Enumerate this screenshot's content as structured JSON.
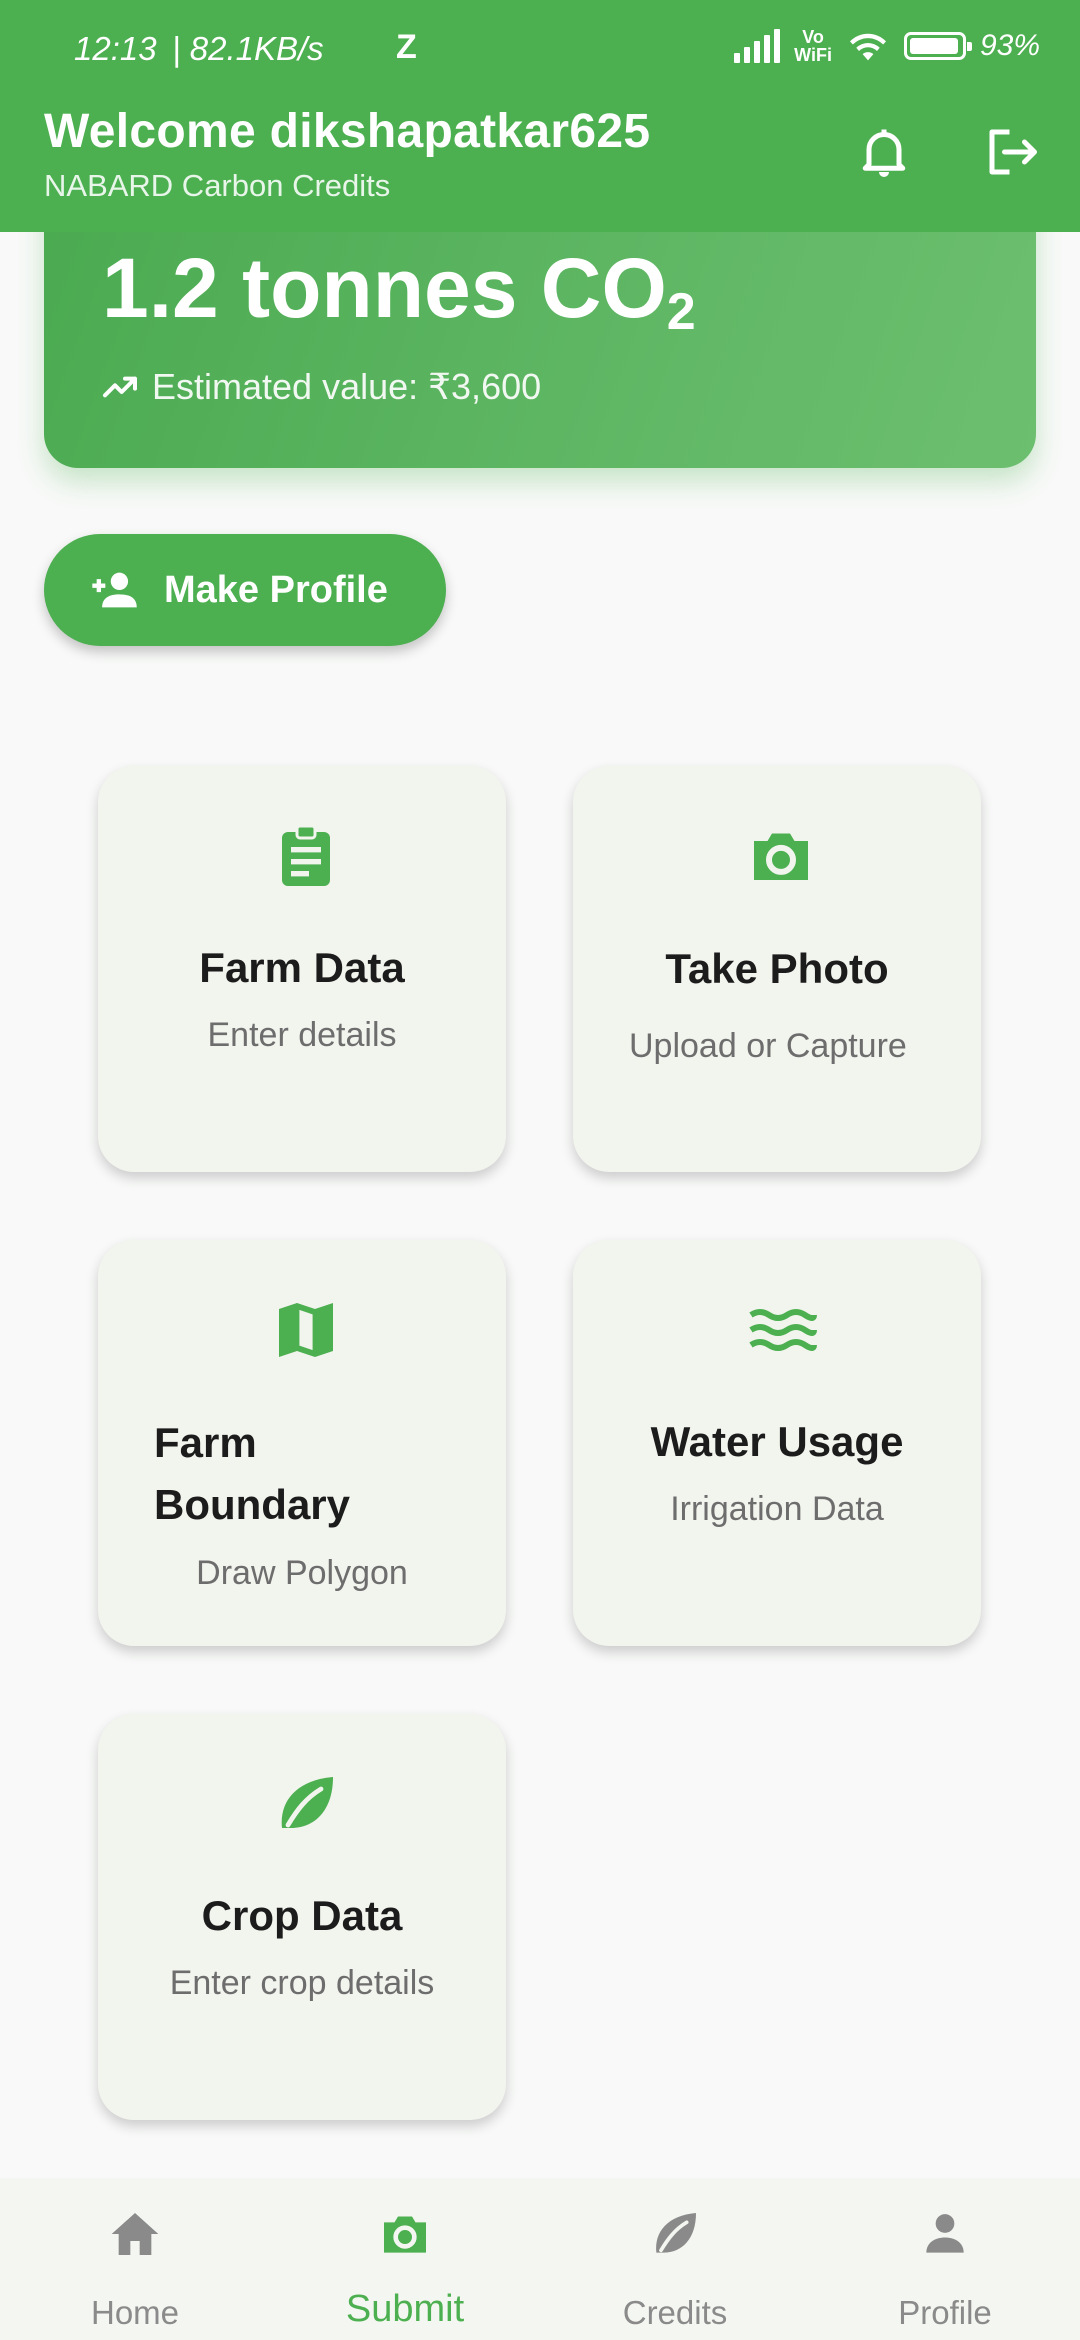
{
  "status_bar": {
    "time": "12:13",
    "network_speed": "82.1KB/s",
    "extra": "Z",
    "volte": "Vo\nWiFi",
    "battery": "93%"
  },
  "header": {
    "title": "Welcome dikshapatkar625",
    "subtitle": "NABARD Carbon Credits"
  },
  "credits_card": {
    "amount": "1.2 tonnes CO",
    "amount_sub": "2",
    "estimated": "Estimated value: ₹3,600"
  },
  "make_profile_label": "Make Profile",
  "tiles": [
    {
      "title": "Farm Data",
      "subtitle": "Enter details",
      "icon": "clipboard-icon"
    },
    {
      "title": "Take Photo",
      "subtitle": "Upload or Capture",
      "icon": "camera-icon"
    },
    {
      "title": "Farm Boundary",
      "subtitle": "Draw Polygon",
      "icon": "map-icon"
    },
    {
      "title": "Water Usage",
      "subtitle": "Irrigation Data",
      "icon": "water-icon"
    },
    {
      "title": "Crop Data",
      "subtitle": "Enter crop details",
      "icon": "leaf-icon"
    }
  ],
  "nav": [
    {
      "label": "Home",
      "icon": "home-icon"
    },
    {
      "label": "Submit",
      "icon": "camera-icon",
      "active": true
    },
    {
      "label": "Credits",
      "icon": "leaf-icon"
    },
    {
      "label": "Profile",
      "icon": "person-icon"
    }
  ],
  "colors": {
    "primary": "#4caf50",
    "tile_bg": "#f2f4ee",
    "muted_text": "#6d6d6d",
    "nav_inactive": "#8a8a8a"
  }
}
